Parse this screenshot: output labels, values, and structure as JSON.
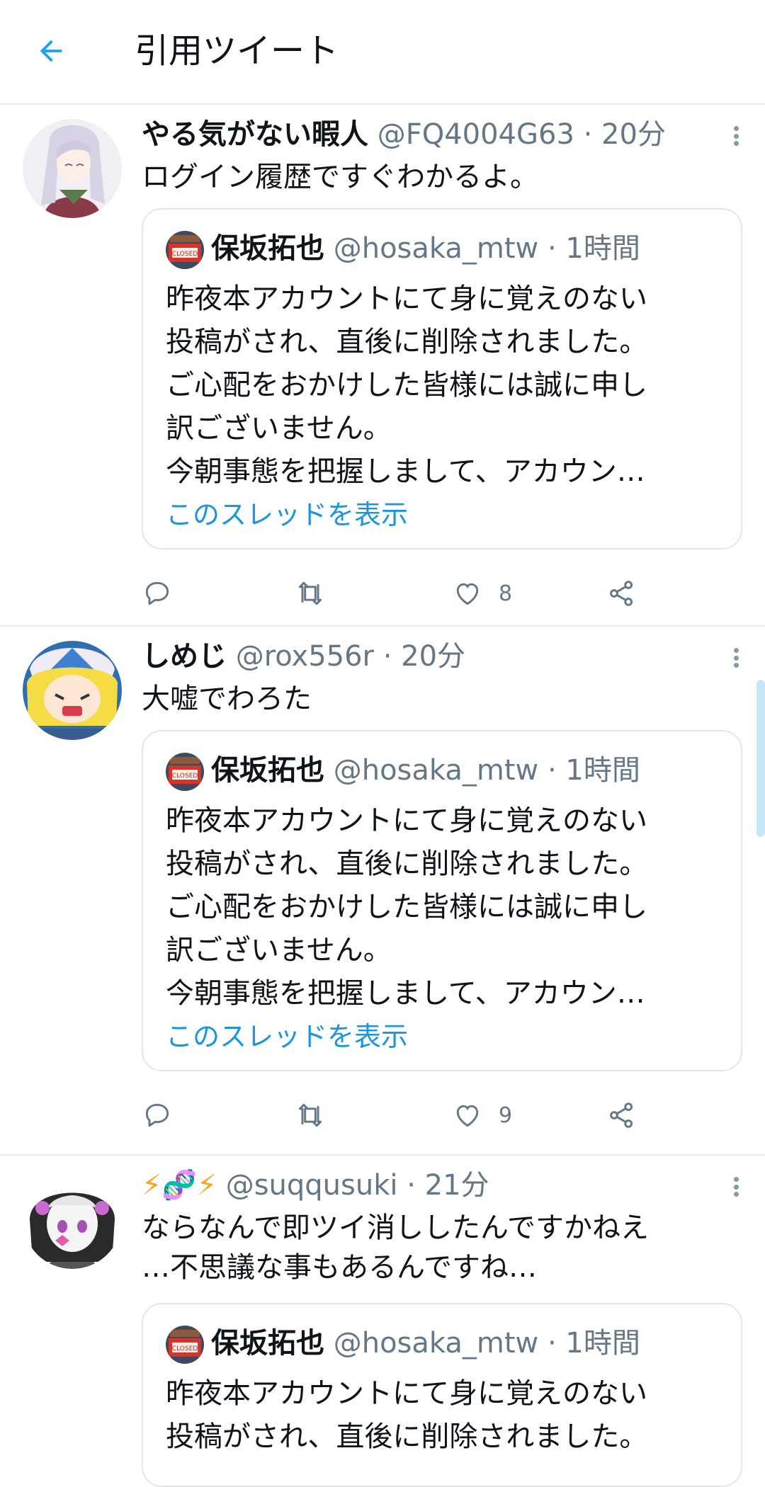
{
  "header": {
    "title": "引用ツイート"
  },
  "tweets": [
    {
      "name": "やる気がない暇人",
      "meta": "@FQ4004G63 · 20分",
      "text_lines": [
        "ログイン履歴ですぐわかるよ。"
      ],
      "quote": {
        "name": "保坂拓也",
        "meta": "@hosaka_mtw · 1時間",
        "lines": [
          "昨夜本アカウントにて身に覚えのない",
          "投稿がされ、直後に削除されました。",
          "ご心配をおかけした皆様には誠に申し",
          "訳ございません。",
          "今朝事態を把握しまして、アカウン…"
        ],
        "link": "このスレッドを表示"
      },
      "likes": "8"
    },
    {
      "name": "しめじ",
      "meta": "@rox556r · 20分",
      "text_lines": [
        "大嘘でわろた"
      ],
      "quote": {
        "name": "保坂拓也",
        "meta": "@hosaka_mtw · 1時間",
        "lines": [
          "昨夜本アカウントにて身に覚えのない",
          "投稿がされ、直後に削除されました。",
          "ご心配をおかけした皆様には誠に申し",
          "訳ございません。",
          "今朝事態を把握しまして、アカウン…"
        ],
        "link": "このスレッドを表示"
      },
      "likes": "9"
    },
    {
      "name": "⚡🧬⚡",
      "meta": "@suqqusuki · 21分",
      "text_lines": [
        "ならなんで即ツイ消ししたんですかねえ",
        "…不思議な事もあるんですね…"
      ],
      "quote": {
        "name": "保坂拓也",
        "meta": "@hosaka_mtw · 1時間",
        "lines": [
          "昨夜本アカウントにて身に覚えのない",
          "投稿がされ、直後に削除されました。"
        ]
      }
    }
  ],
  "colors": {
    "accent": "#1b95e0",
    "text": "#0f1419",
    "muted": "#657786",
    "border": "#e1e8ed"
  },
  "icons": [
    "back-arrow-icon",
    "more-vert-icon",
    "reply-icon",
    "retweet-icon",
    "like-icon",
    "share-icon"
  ]
}
